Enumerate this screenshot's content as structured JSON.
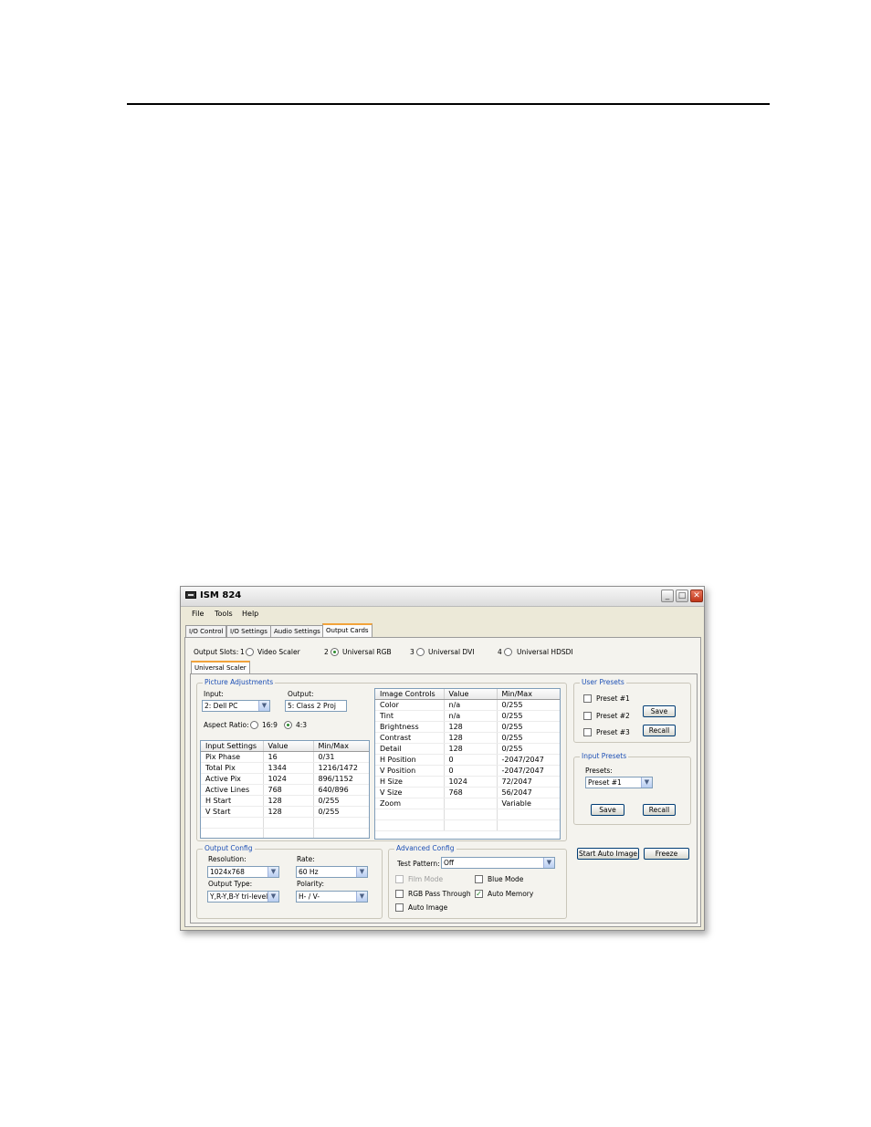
{
  "window": {
    "title": "ISM 824"
  },
  "menu": [
    "File",
    "Tools",
    "Help"
  ],
  "tabs": [
    "I/O Control",
    "I/O Settings",
    "Audio Settings",
    "Output Cards"
  ],
  "output_slots": {
    "label": "Output Slots:",
    "slots": [
      {
        "num": "1",
        "name": "Video Scaler",
        "selected": false
      },
      {
        "num": "2",
        "name": "Universal RGB",
        "selected": true
      },
      {
        "num": "3",
        "name": "Universal DVI",
        "selected": false
      },
      {
        "num": "4",
        "name": "Universal HDSDI",
        "selected": false
      }
    ]
  },
  "subtab": "Universal Scaler",
  "picture_adjustments": {
    "title": "Picture Adjustments",
    "input_label": "Input:",
    "input_value": "2: Dell PC",
    "output_label": "Output:",
    "output_value": "5: Class 2 Proj",
    "aspect_label": "Aspect Ratio:",
    "aspect_169": "16:9",
    "aspect_43": "4:3",
    "aspect_selected": "4:3"
  },
  "input_settings": {
    "headers": [
      "Input Settings",
      "Value",
      "Min/Max"
    ],
    "rows": [
      [
        "Pix Phase",
        "16",
        "0/31"
      ],
      [
        "Total Pix",
        "1344",
        "1216/1472"
      ],
      [
        "Active Pix",
        "1024",
        "896/1152"
      ],
      [
        "Active Lines",
        "768",
        "640/896"
      ],
      [
        "H Start",
        "128",
        "0/255"
      ],
      [
        "V Start",
        "128",
        "0/255"
      ]
    ]
  },
  "image_controls": {
    "headers": [
      "Image Controls",
      "Value",
      "Min/Max"
    ],
    "rows": [
      [
        "Color",
        "n/a",
        "0/255"
      ],
      [
        "Tint",
        "n/a",
        "0/255"
      ],
      [
        "Brightness",
        "128",
        "0/255"
      ],
      [
        "Contrast",
        "128",
        "0/255"
      ],
      [
        "Detail",
        "128",
        "0/255"
      ],
      [
        "H Position",
        "0",
        "-2047/2047"
      ],
      [
        "V Position",
        "0",
        "-2047/2047"
      ],
      [
        "H Size",
        "1024",
        "72/2047"
      ],
      [
        "V Size",
        "768",
        "56/2047"
      ],
      [
        "Zoom",
        "",
        "Variable"
      ]
    ]
  },
  "user_presets": {
    "title": "User Presets",
    "items": [
      "Preset #1",
      "Preset #2",
      "Preset #3"
    ],
    "save": "Save",
    "recall": "Recall"
  },
  "input_presets": {
    "title": "Input Presets",
    "presets_label": "Presets:",
    "presets_value": "Preset #1",
    "save": "Save",
    "recall": "Recall"
  },
  "actions": {
    "auto_image": "Start Auto Image",
    "freeze": "Freeze"
  },
  "output_config": {
    "title": "Output Config",
    "resolution_label": "Resolution:",
    "resolution_value": "1024x768",
    "rate_label": "Rate:",
    "rate_value": "60 Hz",
    "output_type_label": "Output Type:",
    "output_type_value": "Y,R-Y,B-Y tri-level",
    "polarity_label": "Polarity:",
    "polarity_value": "H- / V-"
  },
  "advanced_config": {
    "title": "Advanced Config",
    "test_pattern_label": "Test Pattern:",
    "test_pattern_value": "Off",
    "film_mode": "Film Mode",
    "blue_mode": "Blue Mode",
    "rgb_pass_through": "RGB Pass Through",
    "auto_memory": "Auto Memory",
    "auto_image": "Auto Image",
    "auto_memory_checked": true
  }
}
